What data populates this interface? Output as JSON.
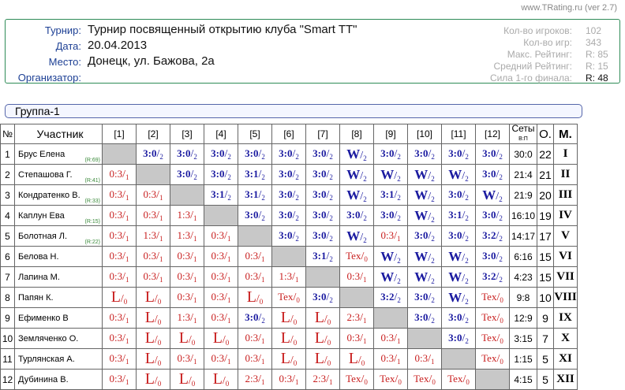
{
  "version": "www.TRating.ru (ver 2.7)",
  "info": {
    "labels": [
      "Турнир:",
      "Дата:",
      "Место:",
      "Организатор:"
    ],
    "values": [
      "Турнир посвященный открытию клуба \"Smart TT\"",
      "20.04.2013",
      "Донецк, ул. Бажова, 2а",
      ""
    ]
  },
  "stats": [
    {
      "label": "Кол-во игроков:",
      "value": "102"
    },
    {
      "label": "Кол-во игр:",
      "value": "343"
    },
    {
      "label": "Макс. Рейтинг:",
      "value": "R:  85"
    },
    {
      "label": "Средний Рейтинг:",
      "value": "R:  15"
    },
    {
      "label": "Сила 1-го финала:",
      "value": "R:  48"
    }
  ],
  "group_title": "Группа-1",
  "headers": {
    "num": "№",
    "player": "Участник",
    "cols": [
      "[1]",
      "[2]",
      "[3]",
      "[4]",
      "[5]",
      "[6]",
      "[7]",
      "[8]",
      "[9]",
      "[10]",
      "[11]",
      "[12]"
    ],
    "sets": "Сеты",
    "sets_sub": "В:П",
    "points": "О.",
    "place": "М."
  },
  "rows": [
    {
      "n": "1",
      "name": "Брус Елена",
      "rating": "(R:69)",
      "cells": [
        "X",
        "3:0/2",
        "3:0/2",
        "3:0/2",
        "3:0/2",
        "3:0/2",
        "3:0/2",
        "W/2",
        "3:0/2",
        "3:0/2",
        "3:0/2",
        "3:0/2"
      ],
      "sets": "30:0",
      "points": "22",
      "place": "I"
    },
    {
      "n": "2",
      "name": "Степашова Г.",
      "rating": "(R:41)",
      "cells": [
        "0:3/1",
        "X",
        "3:0/2",
        "3:0/2",
        "3:1/2",
        "3:0/2",
        "3:0/2",
        "W/2",
        "W/2",
        "W/2",
        "W/2",
        "3:0/2"
      ],
      "sets": "21:4",
      "points": "21",
      "place": "II"
    },
    {
      "n": "3",
      "name": "Кондратенко В.",
      "rating": "(R:33)",
      "cells": [
        "0:3/1",
        "0:3/1",
        "X",
        "3:1/2",
        "3:1/2",
        "3:0/2",
        "3:0/2",
        "W/2",
        "3:1/2",
        "W/2",
        "3:0/2",
        "W/2"
      ],
      "sets": "21:9",
      "points": "20",
      "place": "III"
    },
    {
      "n": "4",
      "name": "Каплун Ева",
      "rating": "(R:15)",
      "cells": [
        "0:3/1",
        "0:3/1",
        "1:3/1",
        "X",
        "3:0/2",
        "3:0/2",
        "3:0/2",
        "3:0/2",
        "3:0/2",
        "W/2",
        "3:1/2",
        "3:0/2"
      ],
      "sets": "16:10",
      "points": "19",
      "place": "IV"
    },
    {
      "n": "5",
      "name": "Болотная Л.",
      "rating": "(R:22)",
      "cells": [
        "0:3/1",
        "1:3/1",
        "1:3/1",
        "0:3/1",
        "X",
        "3:0/2",
        "3:0/2",
        "W/2",
        "0:3/1",
        "3:0/2",
        "3:0/2",
        "3:2/2"
      ],
      "sets": "14:17",
      "points": "17",
      "place": "V"
    },
    {
      "n": "6",
      "name": "Белова Н.",
      "rating": "",
      "cells": [
        "0:3/1",
        "0:3/1",
        "0:3/1",
        "0:3/1",
        "0:3/1",
        "X",
        "3:1/2",
        "Tex/0",
        "W/2",
        "W/2",
        "W/2",
        "3:0/2"
      ],
      "sets": "6:16",
      "points": "15",
      "place": "VI"
    },
    {
      "n": "7",
      "name": "Лапина М.",
      "rating": "",
      "cells": [
        "0:3/1",
        "0:3/1",
        "0:3/1",
        "0:3/1",
        "0:3/1",
        "1:3/1",
        "X",
        "0:3/1",
        "W/2",
        "W/2",
        "W/2",
        "3:2/2"
      ],
      "sets": "4:23",
      "points": "15",
      "place": "VII"
    },
    {
      "n": "8",
      "name": "Папян К.",
      "rating": "",
      "cells": [
        "L/0",
        "L/0",
        "0:3/1",
        "0:3/1",
        "L/0",
        "Tex/0",
        "3:0/2",
        "X",
        "3:2/2",
        "3:0/2",
        "W/2",
        "Tex/0"
      ],
      "sets": "9:8",
      "points": "10",
      "place": "VIII"
    },
    {
      "n": "9",
      "name": "Ефименко В",
      "rating": "",
      "cells": [
        "0:3/1",
        "L/0",
        "1:3/1",
        "0:3/1",
        "3:0/2",
        "L/0",
        "L/0",
        "2:3/1",
        "X",
        "3:0/2",
        "3:0/2",
        "Tex/0"
      ],
      "sets": "12:9",
      "points": "9",
      "place": "IX"
    },
    {
      "n": "10",
      "name": "Земляченко О.",
      "rating": "",
      "cells": [
        "0:3/1",
        "L/0",
        "L/0",
        "L/0",
        "0:3/1",
        "L/0",
        "L/0",
        "0:3/1",
        "0:3/1",
        "X",
        "3:0/2",
        "Tex/0"
      ],
      "sets": "3:15",
      "points": "7",
      "place": "X"
    },
    {
      "n": "11",
      "name": "Турлянская А.",
      "rating": "",
      "cells": [
        "0:3/1",
        "L/0",
        "0:3/1",
        "0:3/1",
        "0:3/1",
        "L/0",
        "L/0",
        "L/0",
        "0:3/1",
        "0:3/1",
        "X",
        "Tex/0"
      ],
      "sets": "1:15",
      "points": "5",
      "place": "XI"
    },
    {
      "n": "12",
      "name": "Дубинина В.",
      "rating": "",
      "cells": [
        "0:3/1",
        "L/0",
        "L/0",
        "L/0",
        "2:3/1",
        "0:3/1",
        "2:3/1",
        "Tex/0",
        "Tex/0",
        "Tex/0",
        "Tex/0",
        "X"
      ],
      "sets": "4:15",
      "points": "5",
      "place": "XII"
    }
  ],
  "colors": {
    "win": "#1a1aa0",
    "loss": "#c81e1e",
    "diag": "#c8c8c8",
    "frame": "#2e8b57"
  }
}
